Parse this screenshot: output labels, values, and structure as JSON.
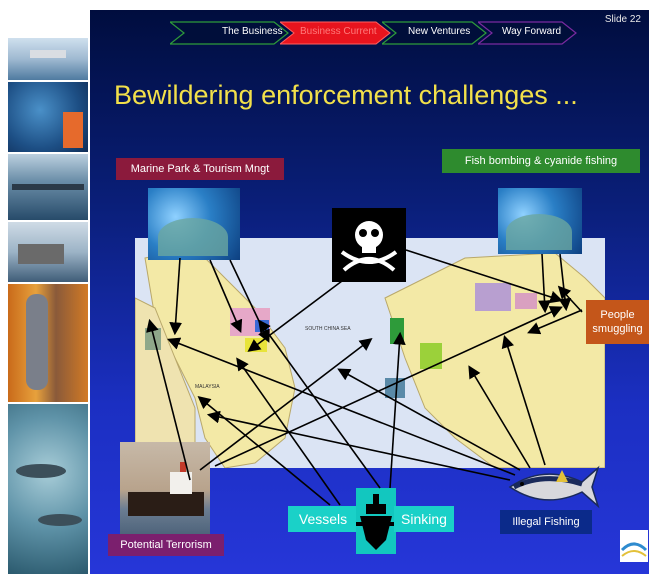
{
  "slide_number": "Slide 22",
  "nav": {
    "items": [
      {
        "label": "The Business",
        "state": "inactive"
      },
      {
        "label": "Business Current",
        "state": "active"
      },
      {
        "label": "New Ventures",
        "state": "inactive"
      },
      {
        "label": "Way Forward",
        "state": "inactive"
      }
    ]
  },
  "title": "Bewildering enforcement challenges ...",
  "labels": {
    "marine_park": "Marine Park & Tourism Mngt",
    "fish_bombing": "Fish bombing & cyanide fishing",
    "people_smuggling": "People smuggling",
    "potential_terrorism": "Potential Terrorism",
    "vessels": "Vessels",
    "sinking": "Sinking",
    "illegal_fishing": "Illegal Fishing"
  },
  "colors": {
    "title": "#f2e04a",
    "nav_active": "#e8141e",
    "label_marine": "#8b1a3c",
    "label_fish_bombing": "#2e8b2e",
    "label_people": "#c4561a",
    "label_terrorism": "#7b1f6e",
    "label_vessels": "#1ad1c8",
    "label_illegal": "#0b2a8a"
  },
  "icons": [
    "jolly-roger-icon",
    "ship-icon",
    "tuna-icon",
    "tanker-icon",
    "logo-icon"
  ]
}
